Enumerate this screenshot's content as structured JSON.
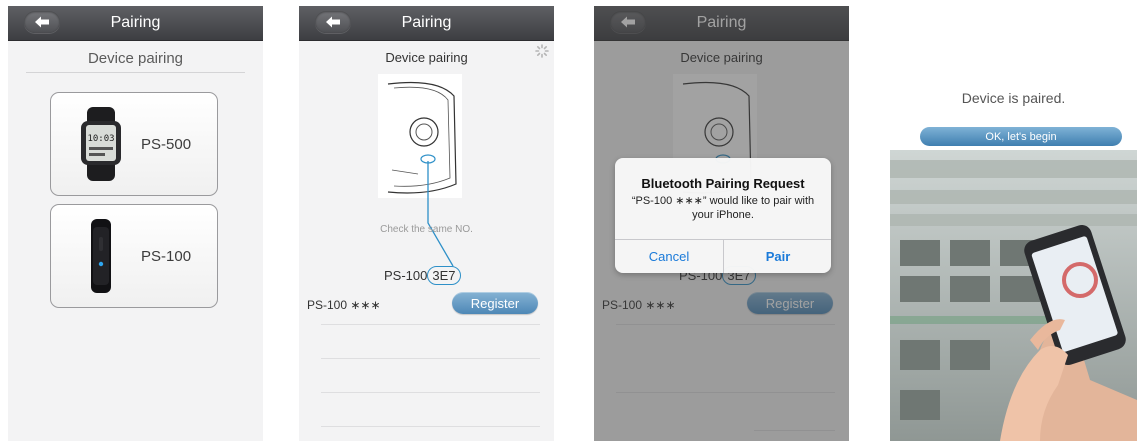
{
  "screen1": {
    "nav_title": "Pairing",
    "section_title": "Device pairing",
    "devices": [
      {
        "label": "PS-500",
        "icon": "smartwatch-icon",
        "display_time": "10:03"
      },
      {
        "label": "PS-100",
        "icon": "fitness-band-icon"
      }
    ]
  },
  "screen2": {
    "nav_title": "Pairing",
    "section_title": "Device pairing",
    "check_text": "Check the same NO.",
    "code_prefix": "PS-100",
    "code_suffix": "3E7",
    "device_name": "PS-100 ∗∗∗",
    "register_label": "Register"
  },
  "screen3": {
    "nav_title": "Pairing",
    "section_title": "Device pairing",
    "code_prefix": "PS-100",
    "code_suffix": "3E7",
    "device_name": "PS-100 ∗∗∗",
    "register_label": "Register",
    "alert": {
      "title": "Bluetooth Pairing Request",
      "message": "“PS-100 ∗∗∗” would like to pair with your iPhone.",
      "cancel_label": "Cancel",
      "pair_label": "Pair"
    }
  },
  "screen4": {
    "paired_text": "Device is paired.",
    "begin_label": "OK, let's begin"
  },
  "colors": {
    "navbar": "#4a4b4f",
    "accent_blue": "#4d87b6",
    "ios_blue": "#1a7ad9"
  }
}
